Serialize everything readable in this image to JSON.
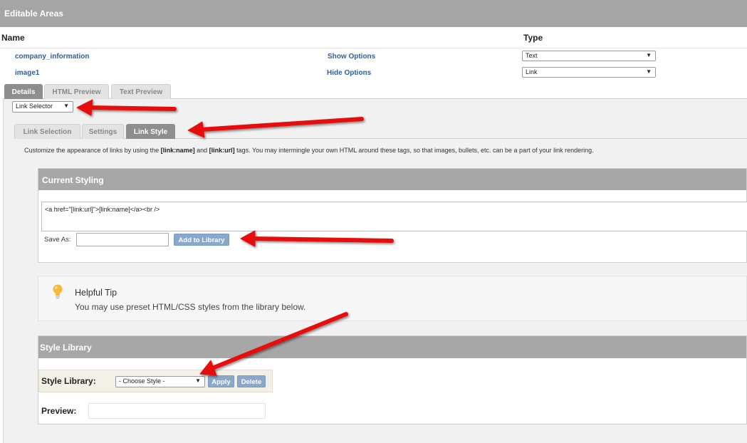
{
  "header": {
    "title": "Editable Areas"
  },
  "columns": {
    "name": "Name",
    "type": "Type"
  },
  "areas": [
    {
      "name": "company_information",
      "toggle": "Show Options",
      "type": "Text"
    },
    {
      "name": "image1",
      "toggle": "Hide Options",
      "type": "Link"
    }
  ],
  "tabs": [
    "Details",
    "HTML Preview",
    "Text Preview"
  ],
  "selector": {
    "value": "Link Selector"
  },
  "subtabs": [
    "Link Selection",
    "Settings",
    "Link Style"
  ],
  "description": {
    "part1": "Customize the appearance of links by using the ",
    "tag1": "[link:name]",
    "part2": " and ",
    "tag2": "[link:url]",
    "part3": " tags. You may intermingle your own HTML around these tags, so that images, bullets, etc. can be a part of your link rendering."
  },
  "current_styling": {
    "title": "Current Styling",
    "code": "<a href=\"[link:url]\">[link:name]</a><br />",
    "save_as_label": "Save As:",
    "save_as_value": "",
    "add_button": "Add to Library"
  },
  "tip": {
    "title": "Helpful Tip",
    "text": "You may use preset HTML/CSS styles from the library below."
  },
  "style_library": {
    "title": "Style Library",
    "label": "Style Library:",
    "choose": "- Choose Style -",
    "apply": "Apply",
    "delete": "Delete",
    "preview_label": "Preview:"
  },
  "colors": {
    "accent_link": "#2f5e9a",
    "header_gray": "#a5a5a5",
    "arrow_red": "#e81010",
    "button_blue": "#89a8cb"
  }
}
